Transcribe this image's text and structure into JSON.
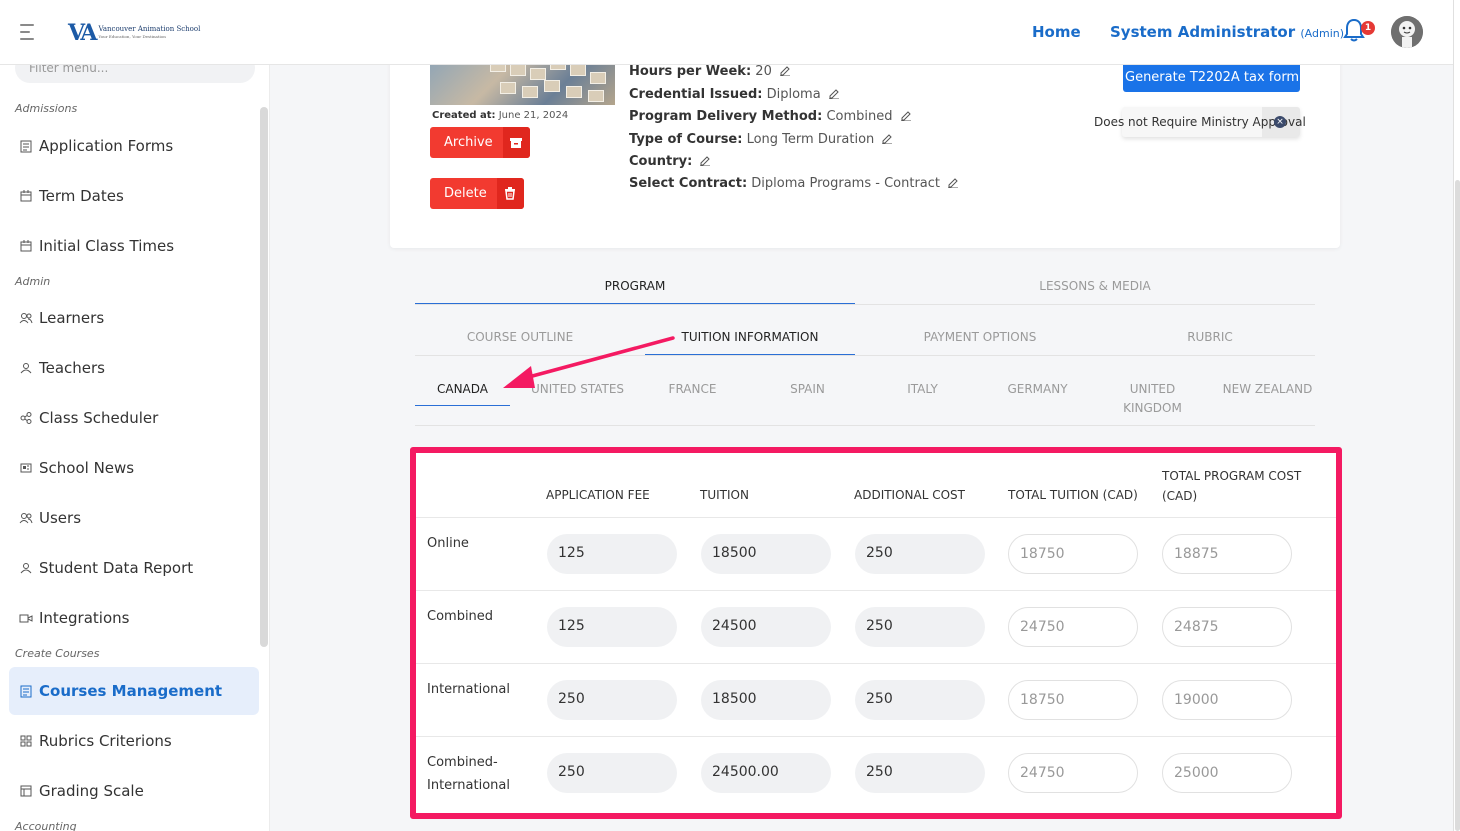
{
  "header": {
    "logo_mark": "VA",
    "logo_line1": "Vancouver Animation School",
    "logo_line2": "Your Education, Your Destination",
    "home": "Home",
    "user_name": "System Administrator",
    "user_role": "(Admin)",
    "notification_count": "1"
  },
  "sidebar": {
    "filter_placeholder": "Filter menu...",
    "sections": {
      "admissions": "Admissions",
      "admin": "Admin",
      "create_courses": "Create Courses",
      "accounting": "Accounting"
    },
    "items": [
      {
        "label": "Application Forms",
        "icon": "form-icon"
      },
      {
        "label": "Term Dates",
        "icon": "calendar-icon"
      },
      {
        "label": "Initial Class Times",
        "icon": "calendar-icon"
      },
      {
        "label": "Learners",
        "icon": "users-icon"
      },
      {
        "label": "Teachers",
        "icon": "user-icon"
      },
      {
        "label": "Class Scheduler",
        "icon": "share-icon"
      },
      {
        "label": "School News",
        "icon": "news-icon"
      },
      {
        "label": "Users",
        "icon": "users-icon"
      },
      {
        "label": "Student Data Report",
        "icon": "user-icon"
      },
      {
        "label": "Integrations",
        "icon": "video-icon"
      },
      {
        "label": "Courses Management",
        "icon": "form-icon",
        "active": true
      },
      {
        "label": "Rubrics Criterions",
        "icon": "grid-icon"
      },
      {
        "label": "Grading Scale",
        "icon": "table-icon"
      }
    ]
  },
  "course": {
    "created_label": "Created at:",
    "created_date": "June 21, 2024",
    "archive_label": "Archive",
    "delete_label": "Delete",
    "fields": [
      {
        "label": "Hours per Week:",
        "value": "20"
      },
      {
        "label": "Credential Issued:",
        "value": "Diploma"
      },
      {
        "label": "Program Delivery Method:",
        "value": "Combined"
      },
      {
        "label": "Type of Course:",
        "value": "Long Term Duration"
      },
      {
        "label": "Country:",
        "value": ""
      },
      {
        "label": "Select Contract:",
        "value": "Diploma Programs - Contract"
      }
    ],
    "tax_form_button": "Generate T2202A tax form",
    "ministry_toggle": "Does not Require Ministry Approval"
  },
  "tabs": {
    "main": [
      "PROGRAM",
      "LESSONS & MEDIA"
    ],
    "sub": [
      "COURSE OUTLINE",
      "TUITION INFORMATION",
      "PAYMENT OPTIONS",
      "RUBRIC"
    ],
    "countries": [
      "CANADA",
      "UNITED STATES",
      "FRANCE",
      "SPAIN",
      "ITALY",
      "GERMANY",
      "UNITED KINGDOM",
      "NEW ZEALAND"
    ]
  },
  "tuition": {
    "columns": [
      "APPLICATION FEE",
      "TUITION",
      "ADDITIONAL COST",
      "TOTAL TUITION (CAD)",
      "TOTAL PROGRAM COST (CAD)"
    ],
    "rows": [
      {
        "label": "Online",
        "values": [
          "125",
          "18500",
          "250",
          "18750",
          "18875"
        ]
      },
      {
        "label": "Combined",
        "values": [
          "125",
          "24500",
          "250",
          "24750",
          "24875"
        ]
      },
      {
        "label": "International",
        "values": [
          "250",
          "18500",
          "250",
          "18750",
          "19000"
        ]
      },
      {
        "label": "Combined-International",
        "values": [
          "250",
          "24500.00",
          "250",
          "24750",
          "25000"
        ]
      }
    ]
  },
  "colors": {
    "accent": "#1a6cc9",
    "danger": "#f23a30",
    "highlight": "#f41a62"
  }
}
